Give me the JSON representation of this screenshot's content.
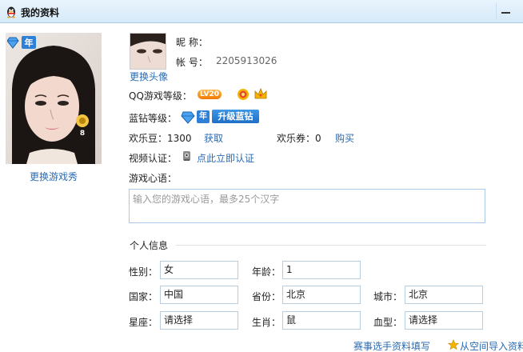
{
  "window": {
    "title": "我的资料"
  },
  "showcase": {
    "change_label": "更换游戏秀",
    "year_badge": "年"
  },
  "profile": {
    "change_avatar": "更换头像",
    "nickname_label": "昵 称：",
    "nickname_value": "",
    "account_label": "帐 号：",
    "account_value": "2205913026",
    "qq_level_label": "QQ游戏等级：",
    "qq_level_badge": "LV20",
    "blue_label": "蓝钻等级：",
    "blue_year": "年",
    "upgrade_blue": "升级蓝钻",
    "beans_label": "欢乐豆：1300",
    "beans_get": "获取",
    "tickets_label": "欢乐券：0",
    "tickets_buy": "购买",
    "video_label": "视频认证：",
    "video_link": "点此立即认证",
    "motto_label": "游戏心语：",
    "motto_placeholder": "输入您的游戏心语，最多25个汉字"
  },
  "personal": {
    "section_title": "个人信息",
    "gender_label": "性别：",
    "gender_value": "女",
    "age_label": "年龄：",
    "age_value": "1",
    "country_label": "国家：",
    "country_value": "中国",
    "province_label": "省份：",
    "province_value": "北京",
    "city_label": "城市：",
    "city_value": "北京",
    "zodiac_label": "星座：",
    "zodiac_value": "请选择",
    "shengxiao_label": "生肖：",
    "shengxiao_value": "鼠",
    "blood_label": "血型：",
    "blood_value": "请选择"
  },
  "footer": {
    "contest_link": "赛事选手资料填写",
    "import_link": "从空间导入资料"
  },
  "colors": {
    "link": "#2a6bb3",
    "titlebar": "#d6e9f8",
    "badge_blue": "#2d7fd8",
    "level_orange": "#f07a00"
  }
}
